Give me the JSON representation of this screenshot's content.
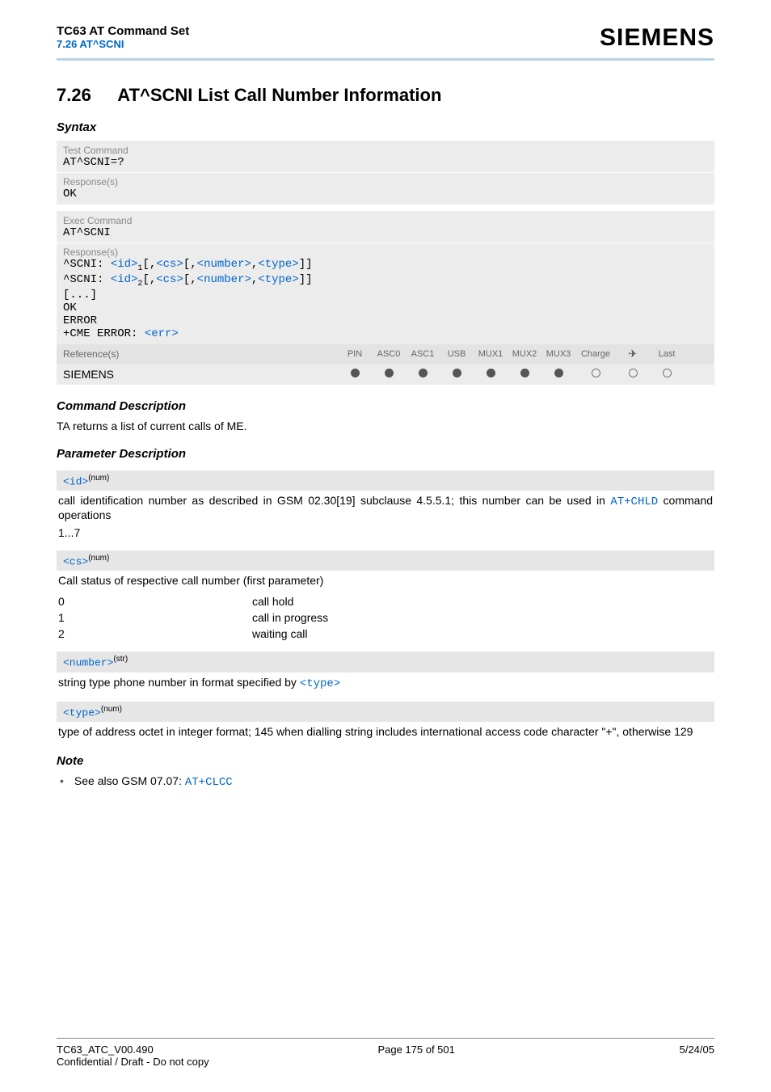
{
  "header": {
    "doc_title": "TC63 AT Command Set",
    "subsection": "7.26 AT^SCNI",
    "logo": "SIEMENS"
  },
  "section": {
    "number": "7.26",
    "title": "AT^SCNI   List Call Number Information"
  },
  "syntax_heading": "Syntax",
  "test_cmd": {
    "label": "Test Command",
    "cmd": "AT^SCNI=?",
    "resp_label": "Response(s)",
    "resp": "OK"
  },
  "exec_cmd": {
    "label": "Exec Command",
    "cmd": "AT^SCNI",
    "resp_label": "Response(s)",
    "line1_prefix": "^SCNI: ",
    "line2_prefix": "^SCNI: ",
    "ellipsis": "[...]",
    "ok": "OK",
    "error": "ERROR",
    "cme": "+CME ERROR: ",
    "err_token": "<err>"
  },
  "tokens": {
    "id": "<id>",
    "cs": "<cs>",
    "number": "<number>",
    "type": "<type>"
  },
  "ref": {
    "label": "Reference(s)",
    "cols": [
      "PIN",
      "ASC0",
      "ASC1",
      "USB",
      "MUX1",
      "MUX2",
      "MUX3",
      "Charge",
      "✈",
      "Last"
    ],
    "vendor": "SIEMENS",
    "dots": [
      "filled",
      "filled",
      "filled",
      "filled",
      "filled",
      "filled",
      "filled",
      "open",
      "open",
      "open"
    ]
  },
  "cmd_desc": {
    "heading": "Command Description",
    "text": "TA returns a list of current calls of ME."
  },
  "param_desc_heading": "Parameter Description",
  "param_id": {
    "name": "<id>",
    "sup": "(num)",
    "text_before": "call identification number as described in GSM 02.30[19] subclause 4.5.5.1; this number can be used in ",
    "link": "AT+CHLD",
    "text_after": " command operations",
    "range": "1...7"
  },
  "param_cs": {
    "name": "<cs>",
    "sup": "(num)",
    "text": "Call status of respective call number (first parameter)",
    "rows": [
      {
        "k": "0",
        "v": "call hold"
      },
      {
        "k": "1",
        "v": "call in progress"
      },
      {
        "k": "2",
        "v": "waiting call"
      }
    ]
  },
  "param_number": {
    "name": "<number>",
    "sup": "(str)",
    "text_before": "string type phone number in format specified by ",
    "link": "<type>"
  },
  "param_type": {
    "name": "<type>",
    "sup": "(num)",
    "text": "type of address octet in integer format; 145 when dialling string includes international access code character \"+\", otherwise 129"
  },
  "note": {
    "heading": "Note",
    "text_before": "See also GSM 07.07: ",
    "link": "AT+CLCC"
  },
  "footer": {
    "left": "TC63_ATC_V00.490",
    "center": "Page 175 of 501",
    "right": "5/24/05",
    "confidential": "Confidential / Draft - Do not copy"
  }
}
